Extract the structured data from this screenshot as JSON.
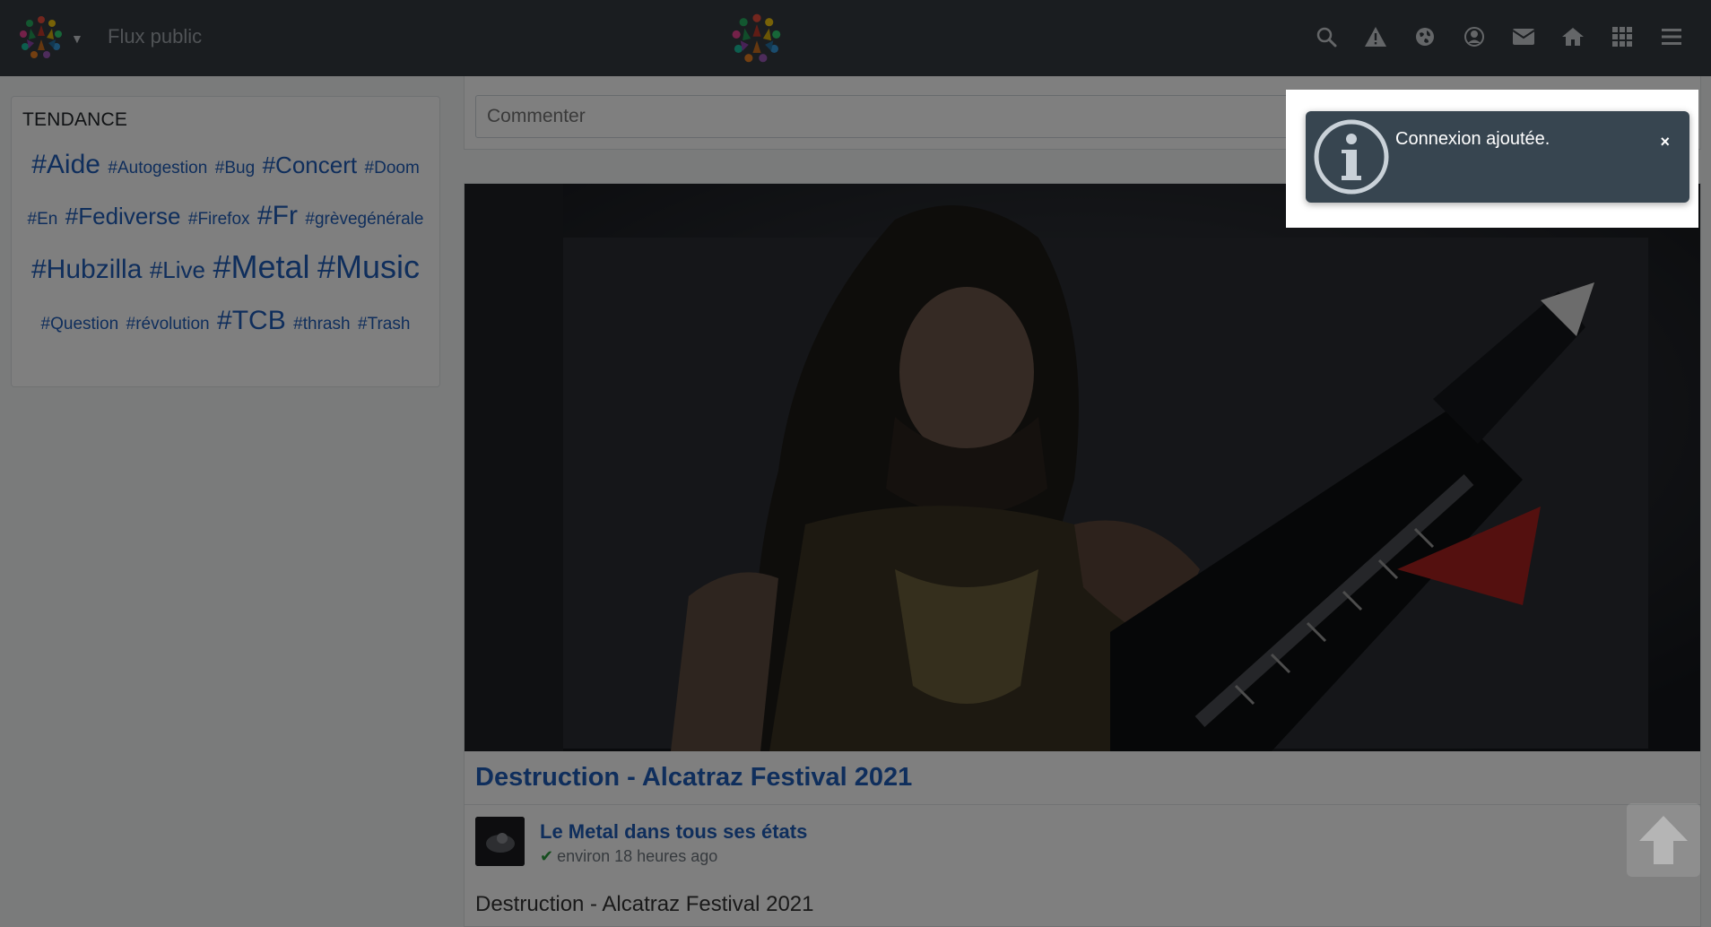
{
  "navbar": {
    "title": "Flux public",
    "icons": [
      "search-icon",
      "alert-icon",
      "globe-icon",
      "user-circle-icon",
      "mail-icon",
      "home-icon",
      "apps-grid-icon",
      "hamburger-menu-icon"
    ]
  },
  "sidebar": {
    "heading": "TENDANCE",
    "tags": [
      {
        "label": "#Aide",
        "size": 3
      },
      {
        "label": "#Autogestion",
        "size": 1
      },
      {
        "label": "#Bug",
        "size": 1
      },
      {
        "label": "#Concert",
        "size": 2
      },
      {
        "label": "#Doom",
        "size": 1
      },
      {
        "label": "#En",
        "size": 1
      },
      {
        "label": "#Fediverse",
        "size": 2
      },
      {
        "label": "#Firefox",
        "size": 1
      },
      {
        "label": "#Fr",
        "size": 3
      },
      {
        "label": "#grèvegénérale",
        "size": 1
      },
      {
        "label": "#Hubzilla",
        "size": 3
      },
      {
        "label": "#Live",
        "size": 2
      },
      {
        "label": "#Metal",
        "size": 4
      },
      {
        "label": "#Music",
        "size": 4
      },
      {
        "label": "#Question",
        "size": 1
      },
      {
        "label": "#révolution",
        "size": 1
      },
      {
        "label": "#TCB",
        "size": 3
      },
      {
        "label": "#thrash",
        "size": 1
      },
      {
        "label": "#Trash",
        "size": 1
      }
    ]
  },
  "comment": {
    "placeholder": "Commenter"
  },
  "post": {
    "title": "Destruction - Alcatraz Festival 2021",
    "author": "Le Metal dans tous ses états",
    "time": "environ 18 heures ago",
    "body": "Destruction - Alcatraz Festival 2021"
  },
  "notification": {
    "message": "Connexion ajoutée.",
    "close_label": "×"
  },
  "colors": {
    "navbar": "#343a40",
    "link": "#1f5cb8",
    "toast": "#374550"
  }
}
